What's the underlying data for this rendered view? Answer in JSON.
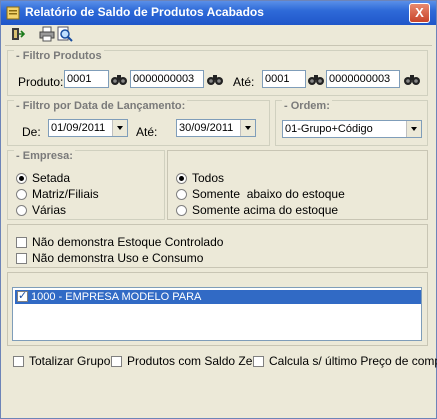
{
  "window": {
    "title": "Relatório de Saldo de Produtos Acabados",
    "close_label": "X"
  },
  "toolbar": {
    "icons": [
      "exit-icon",
      "print-icon",
      "preview-icon"
    ]
  },
  "filtro_produtos": {
    "legend": "Filtro Produtos",
    "produto_label": "Produto:",
    "produto_de_1": "0001",
    "produto_de_2": "0000000003",
    "ate_label": "Até:",
    "produto_ate_1": "0001",
    "produto_ate_2": "0000000003"
  },
  "filtro_data": {
    "legend": "Filtro por Data de Lançamento:",
    "de_label": "De:",
    "de_value": "01/09/2011",
    "ate_label": "Até:",
    "ate_value": "30/09/2011"
  },
  "ordem": {
    "legend": "Ordem:",
    "value": "01-Grupo+Código"
  },
  "empresa": {
    "legend": "Empresa:",
    "options": [
      "Setada",
      "Matriz/Filiais",
      "Várias"
    ],
    "selected": "Setada"
  },
  "estoque": {
    "options": [
      "Todos",
      "Somente  abaixo do estoque",
      "Somente acima do estoque"
    ],
    "selected": "Todos"
  },
  "opcoes": {
    "nao_estoque_controlado": "Não demonstra Estoque Controlado",
    "nao_uso_consumo": "Não demonstra Uso e Consumo"
  },
  "empresas_list": [
    {
      "label": "1000 - EMPRESA MODELO PARA",
      "checked": true
    }
  ],
  "rodape": {
    "totalizar_grupo": "Totalizar Grupo",
    "produtos_saldo_zero": "Produtos com Saldo Zero",
    "calcula_ultimo_preco": "Calcula s/ último Preço de compra"
  },
  "colors": {
    "title_bar": "#1f56c9",
    "selection": "#316ac5",
    "window_bg": "#ece9d8"
  }
}
